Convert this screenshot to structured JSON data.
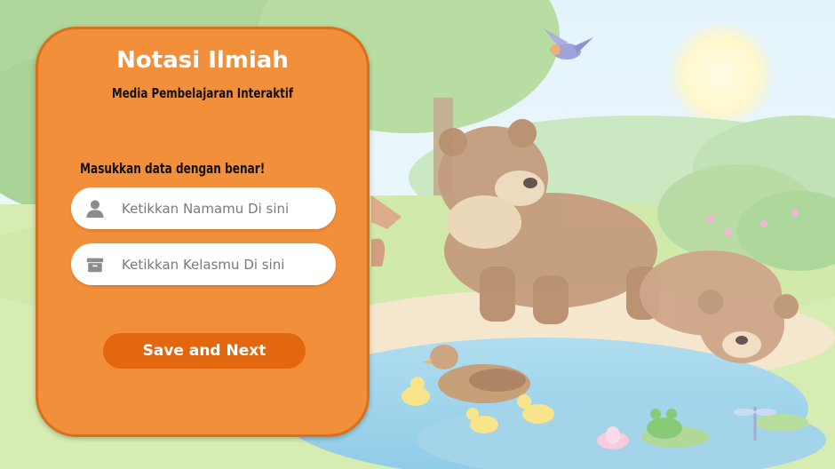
{
  "card": {
    "title": "Notasi Ilmiah",
    "subtitle": "Media Pembelajaran Interaktif",
    "instruction": "Masukkan data dengan benar!"
  },
  "form": {
    "name_placeholder": "Ketikkan Namamu Di sini",
    "name_value": "",
    "class_placeholder": "Ketikkan Kelasmu Di sini",
    "class_value": "",
    "name_icon": "user-icon",
    "class_icon": "archive-box-icon"
  },
  "actions": {
    "save_label": "Save and Next"
  },
  "colors": {
    "card": "#f28f3b",
    "card_border": "#d9701a",
    "button": "#e2670f",
    "field": "#ffffff"
  }
}
